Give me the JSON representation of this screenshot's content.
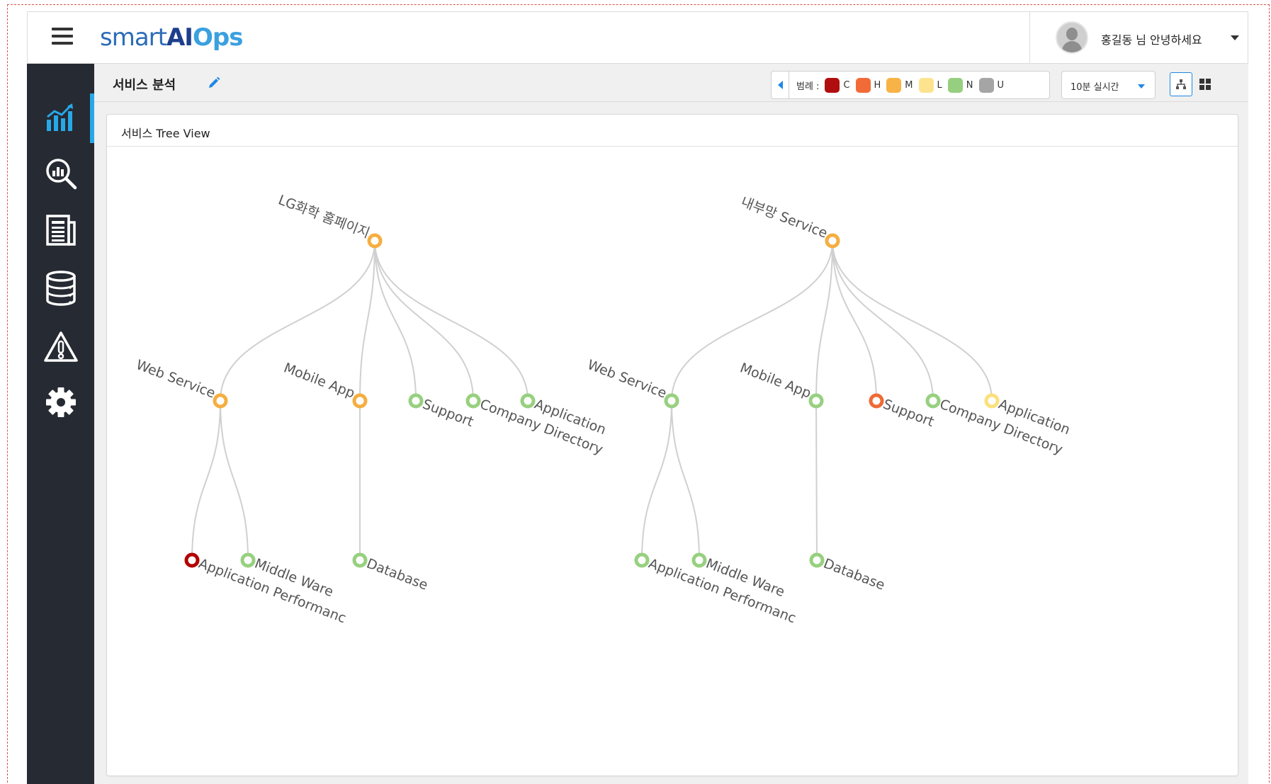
{
  "app": {
    "logo_part1": "smart",
    "logo_part2": "AI",
    "logo_part3": "Ops",
    "greeting": "홍길동 님 안녕하세요"
  },
  "sidebar": {
    "items": [
      {
        "name": "dashboard",
        "icon": "bar-chart-icon",
        "active": true
      },
      {
        "name": "analysis",
        "icon": "search-chart-icon",
        "active": false
      },
      {
        "name": "reports",
        "icon": "document-icon",
        "active": false
      },
      {
        "name": "database",
        "icon": "database-icon",
        "active": false
      },
      {
        "name": "alerts",
        "icon": "warning-icon",
        "active": false
      },
      {
        "name": "settings",
        "icon": "gear-icon",
        "active": false
      }
    ]
  },
  "page": {
    "title": "서비스 분석"
  },
  "legend": {
    "label": "범례 :",
    "items": [
      {
        "code": "C",
        "color": "#b00e0e"
      },
      {
        "code": "H",
        "color": "#f26b36"
      },
      {
        "code": "M",
        "color": "#f8b346"
      },
      {
        "code": "L",
        "color": "#fde38e"
      },
      {
        "code": "N",
        "color": "#95cf7f"
      },
      {
        "code": "U",
        "color": "#a5a5a5"
      }
    ]
  },
  "time_select": {
    "value": "10분 실시간"
  },
  "panel": {
    "title": "서비스 Tree View"
  },
  "status_colors": {
    "C": "#b30000",
    "H": "#f06a35",
    "M": "#f5ae40",
    "L": "#fbe07c",
    "N": "#97d07f",
    "U": "#a5a5a5"
  },
  "trees": [
    {
      "label": "LG화학 홈페이지",
      "status": "M",
      "children": [
        {
          "label": "Web Service",
          "status": "M",
          "children": [
            {
              "label": "Application Performanc",
              "status": "C"
            },
            {
              "label": "Middle Ware",
              "status": "N"
            }
          ]
        },
        {
          "label": "Mobile App",
          "status": "M",
          "children": [
            {
              "label": "Database",
              "status": "N"
            }
          ]
        },
        {
          "label": "Support",
          "status": "N"
        },
        {
          "label": "Company Directory",
          "status": "N"
        },
        {
          "label": "Application",
          "status": "N"
        }
      ]
    },
    {
      "label": "내부망 Service",
      "status": "M",
      "children": [
        {
          "label": "Web Service",
          "status": "N",
          "children": [
            {
              "label": "Application Performanc",
              "status": "N"
            },
            {
              "label": "Middle Ware",
              "status": "N"
            }
          ]
        },
        {
          "label": "Mobile App",
          "status": "N",
          "children": [
            {
              "label": "Database",
              "status": "N"
            }
          ]
        },
        {
          "label": "Support",
          "status": "H"
        },
        {
          "label": "Company Directory",
          "status": "N"
        },
        {
          "label": "Application",
          "status": "L"
        }
      ]
    }
  ]
}
